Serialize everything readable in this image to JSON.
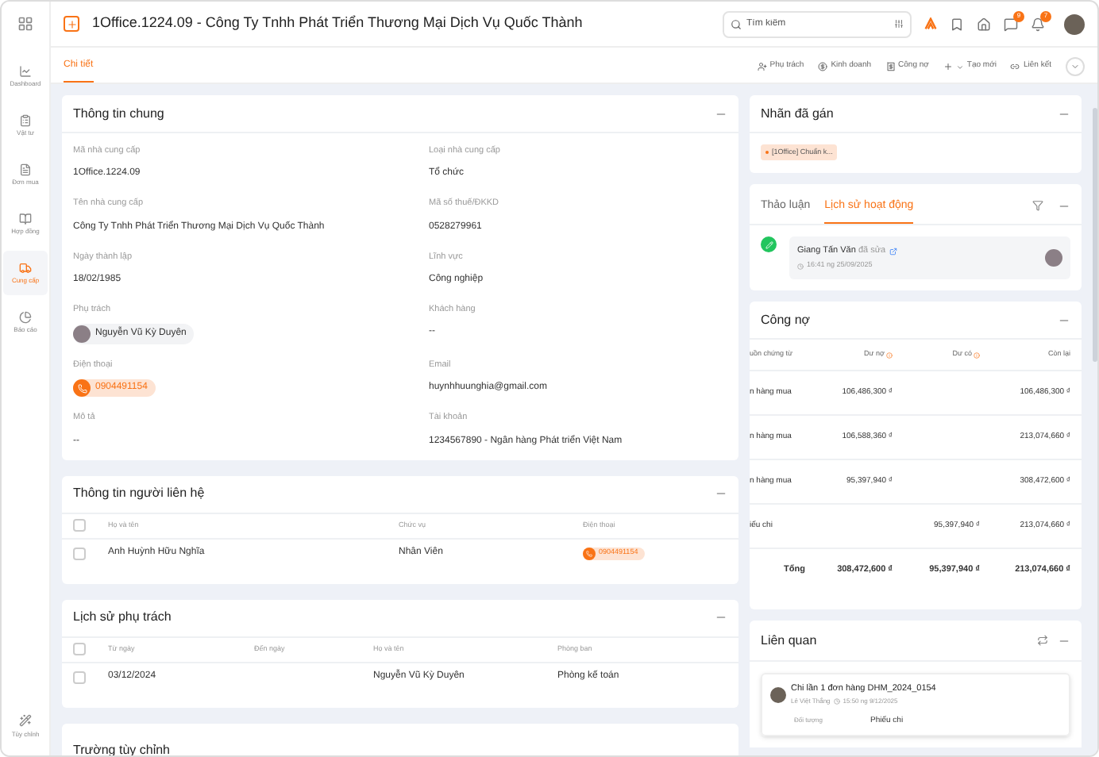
{
  "header": {
    "title": "1Office.1224.09 - Công Ty Tnhh Phát Triển Thương Mại Dịch Vụ Quốc Thành",
    "search": {
      "placeholder": "Tìm kiếm"
    },
    "badges": [
      "9",
      "7"
    ]
  },
  "sidebar": {
    "items": [
      {
        "label": "Dashboard",
        "selected": false
      },
      {
        "label": "Vật tư",
        "selected": false
      },
      {
        "label": "Đơn mua",
        "selected": false
      },
      {
        "label": "Hợp đồng",
        "selected": false
      },
      {
        "label": "Cung cấp",
        "selected": true
      },
      {
        "label": "Báo cáo",
        "selected": false
      }
    ],
    "footer": "Tùy chỉnh"
  },
  "tabs": [
    {
      "label": "Chi tiết",
      "selected": true
    }
  ],
  "actions": [
    "Phụ trách",
    "Kinh doanh",
    "Công nợ",
    "Tạo mới",
    "Liên kết"
  ],
  "general": {
    "title": "Thông tin chung",
    "fields": [
      {
        "label": "Mã nhà cung cấp",
        "value": "1Office.1224.09",
        "kind": "text"
      },
      {
        "label": "Loại nhà cung cấp",
        "value": "Tổ chức",
        "kind": "text"
      },
      {
        "label": "Tên nhà cung cấp",
        "value": "Công Ty Tnhh Phát Triển Thương Mại Dịch Vụ Quốc Thành",
        "kind": "text"
      },
      {
        "label": "Mã số thuế/ĐKKD",
        "value": "0528279961",
        "kind": "text"
      },
      {
        "label": "Ngày thành lập",
        "value": "18/02/1985",
        "kind": "text"
      },
      {
        "label": "Lĩnh vực",
        "value": "Công nghiệp",
        "kind": "text"
      },
      {
        "label": "Phụ trách",
        "value": "Nguyễn Vũ Kỳ Duyên",
        "kind": "person"
      },
      {
        "label": "Khách hàng",
        "value": "--",
        "kind": "text"
      },
      {
        "label": "Điện thoại",
        "value": "0904491154",
        "kind": "phone"
      },
      {
        "label": "Email",
        "value": "huynhhuunghia@gmail.com",
        "kind": "text"
      },
      {
        "label": "Mô tả",
        "value": "--",
        "kind": "text"
      },
      {
        "label": "Tài khoản",
        "value": "1234567890 - Ngân hàng Phát triển Việt Nam",
        "kind": "text"
      }
    ]
  },
  "contacts": {
    "title": "Thông tin người liên hệ",
    "columns": [
      "Họ và tên",
      "Chức vụ",
      "Điện thoại"
    ],
    "all_checked": false,
    "rows": [
      {
        "name": "Anh Huỳnh Hữu Nghĩa",
        "position": "Nhân Viên",
        "phone": "0904491154",
        "checked": false
      }
    ]
  },
  "owners": {
    "title": "Lịch sử phụ trách",
    "columns": [
      "Từ ngày",
      "Đến ngày",
      "Họ và tên",
      "Phòng ban"
    ],
    "all_checked": false,
    "rows": [
      {
        "from": "03/12/2024",
        "to": "",
        "name": "Nguyễn Vũ Kỳ Duyên",
        "department": "Phòng kế toán",
        "checked": false
      }
    ]
  },
  "custom": {
    "title": "Trường tùy chỉnh"
  },
  "labels": {
    "title": "Nhãn đã gán",
    "tags": [
      {
        "text": "[1Office] Chuẩn k...",
        "color": "#f97316"
      }
    ]
  },
  "activity": {
    "tabs": [
      {
        "label": "Thảo luận",
        "selected": false
      },
      {
        "label": "Lịch sử hoạt động",
        "selected": true
      }
    ],
    "entries": [
      {
        "user": "Giang Tấn Văn",
        "action": "đã sửa",
        "time": "16:41 ng 25/09/2025"
      }
    ]
  },
  "debt": {
    "title": "Công nợ",
    "columns": [
      "uồn chứng từ",
      "Dư nợ",
      "Dư có",
      "Còn lại"
    ],
    "rows": [
      {
        "source": "n hàng mua",
        "debit": "106,486,300 ₫",
        "credit": "",
        "balance": "106,486,300 ₫"
      },
      {
        "source": "n hàng mua",
        "debit": "106,588,360 ₫",
        "credit": "",
        "balance": "213,074,660 ₫"
      },
      {
        "source": "n hàng mua",
        "debit": "95,397,940 ₫",
        "credit": "",
        "balance": "308,472,600 ₫"
      },
      {
        "source": "iếu chi",
        "debit": "",
        "credit": "95,397,940 ₫",
        "balance": "213,074,660 ₫"
      }
    ],
    "total": {
      "label": "Tổng",
      "debit": "308,472,600 ₫",
      "credit": "95,397,940 ₫",
      "balance": "213,074,660 ₫"
    }
  },
  "related": {
    "title": "Liên quan",
    "items": [
      {
        "title": "Chi lần 1 đơn hàng DHM_2024_0154",
        "user": "Lê Việt Thắng",
        "time": "15:50 ng 9/12/2025",
        "field_label": "Đối tượng",
        "field_value": "Phiếu chi"
      }
    ]
  }
}
